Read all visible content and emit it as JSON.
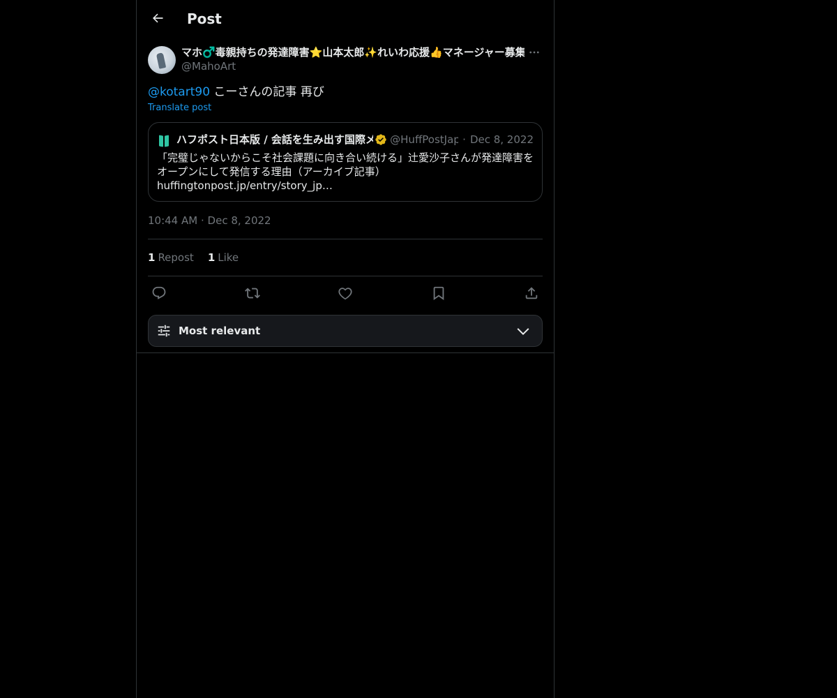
{
  "header": {
    "title": "Post",
    "back_icon": "arrow-left-icon"
  },
  "post": {
    "author_name": "マホ♂️毒親持ちの発達障害⭐️山本太郎✨れいわ応援👍マネージャー募集",
    "author_handle": "@MahoArt",
    "mention": "@kotart90",
    "text": " こーさんの記事 再び",
    "translate_label": "Translate post",
    "quote": {
      "name": "ハフポスト日本版 / 会話を生み出す国際メディア",
      "handle": "@HuffPostJapan",
      "separator": "·",
      "date": "Dec 8, 2022",
      "verified_color": "#e2b719",
      "avatar_color": "#2fc5a3",
      "body": "「完璧じゃないからこそ社会課題に向き合い続ける」辻愛沙子さんが発達障害をオープンにして発信する理由（アーカイブ記事）",
      "link": "huffingtonpost.jp/entry/story_jp…"
    },
    "time": "10:44 AM",
    "time_separator": "·",
    "date": "Dec 8, 2022",
    "stats": {
      "reposts_count": "1",
      "reposts_label": "Repost",
      "likes_count": "1",
      "likes_label": "Like"
    },
    "actions": [
      "reply-icon",
      "repost-icon",
      "like-icon",
      "bookmark-icon",
      "share-icon"
    ]
  },
  "replies_sort": {
    "label": "Most relevant",
    "icon": "sliders-icon",
    "chevron": "chevron-down-icon"
  },
  "colors": {
    "background": "#000000",
    "accent": "#1d9bf0",
    "muted": "#71767b",
    "border": "#2f3336"
  }
}
